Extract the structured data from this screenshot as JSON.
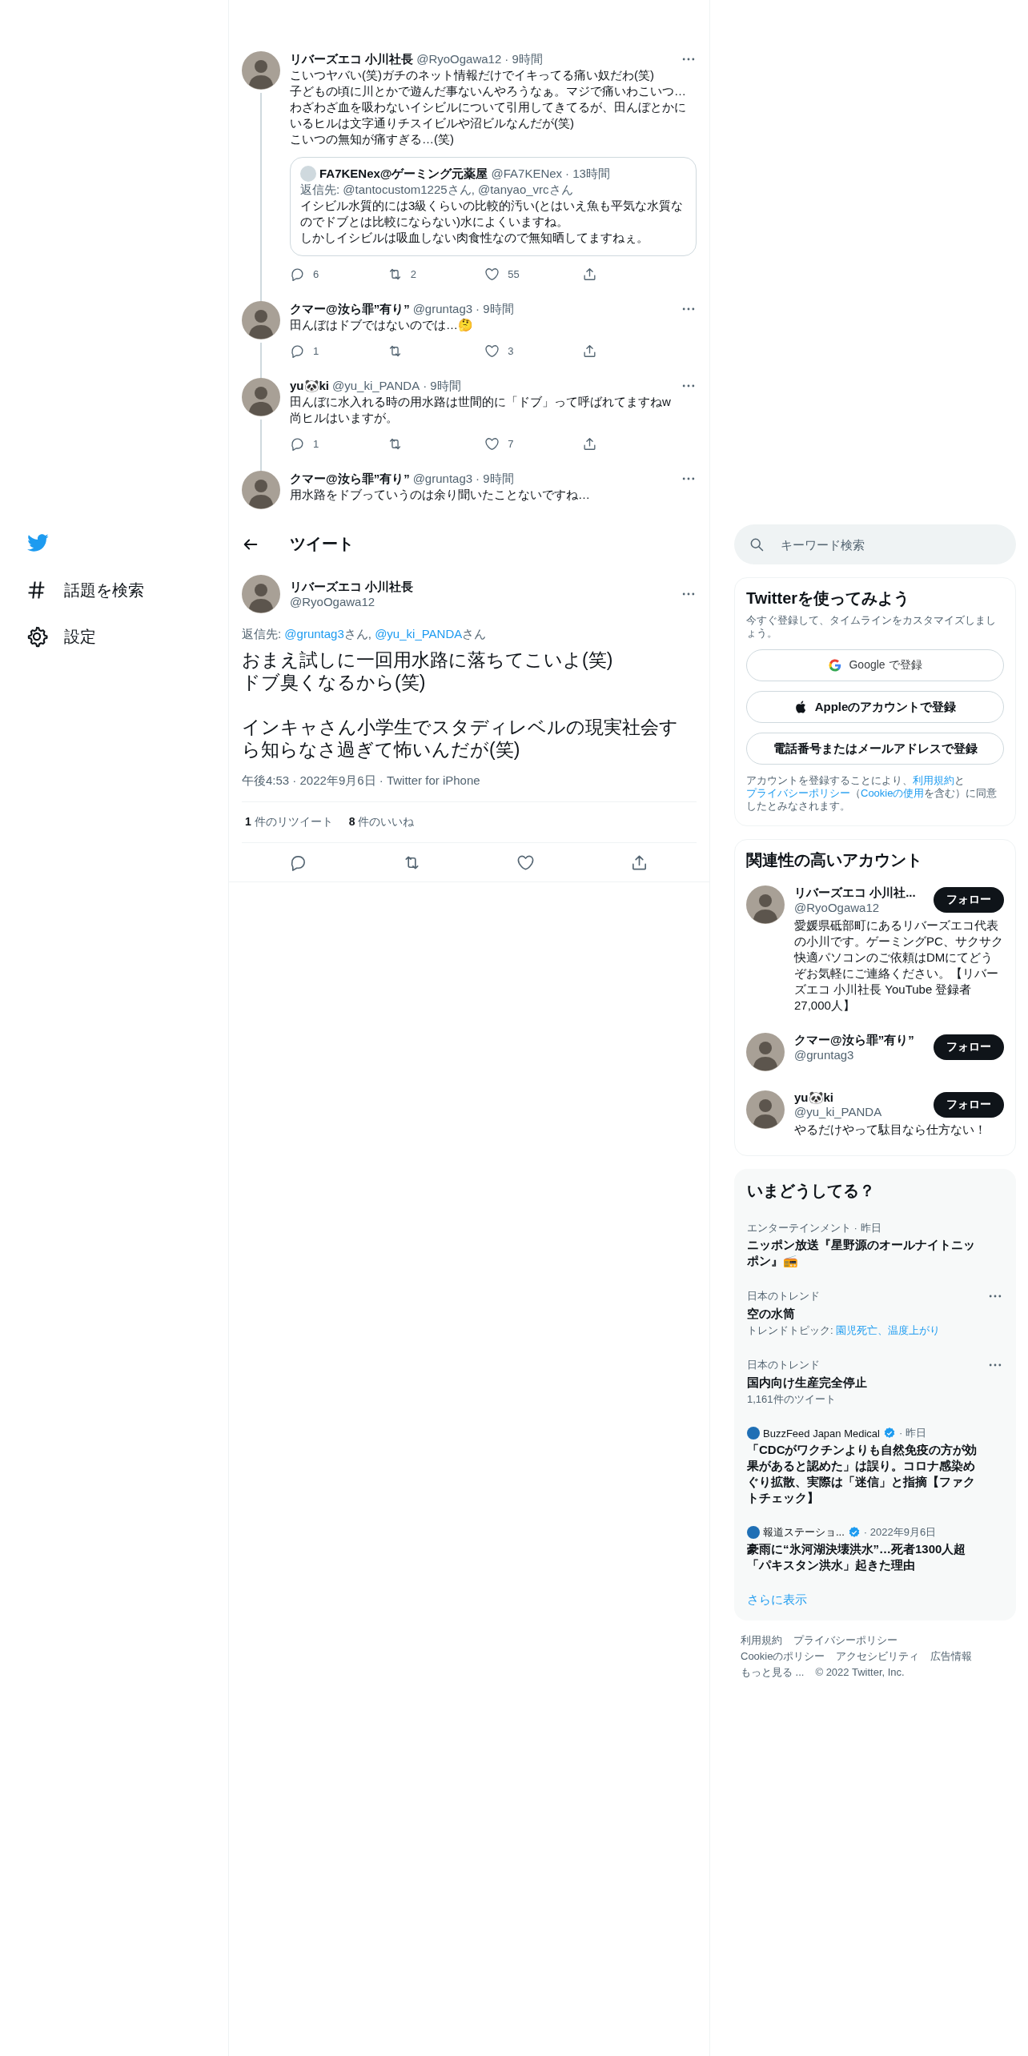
{
  "sidebar": {
    "items": [
      {
        "kind": "hash",
        "label": "話題を検索"
      },
      {
        "kind": "gear",
        "label": "設定"
      }
    ]
  },
  "thread": [
    {
      "name": "リバーズエコ 小川社長",
      "handle": "@RyoOgawa12",
      "time": "· 9時間",
      "text": "こいつヤバい(笑)ガチのネット情報だけでイキってる痛い奴だわ(笑)\n子どもの頃に川とかで遊んだ事ないんやろうなぁ。マジで痛いわこいつ…\nわざわざ血を吸わないイシビルについて引用してきてるが、田んぼとかにいるヒルは文字通りチスイビルや沼ビルなんだが(笑)\nこいつの無知が痛すぎる…(笑)",
      "quote": {
        "name": "FA7KENex@ゲーミング元薬屋",
        "handle": "@FA7KENex",
        "time": "· 13時間",
        "reply": "返信先: @tantocustom1225さん, @tanyao_vrcさん",
        "lines": [
          "イシビル水質的には3級くらいの比較的汚い(とはいえ魚も平気な水質なのでドブとは比較にならない)水によくいますね。",
          "しかしイシビルは吸血しない肉食性なので無知晒してますねぇ。"
        ]
      },
      "actions": [
        {
          "kind": "reply",
          "count": "6"
        },
        {
          "kind": "retweet",
          "count": "2"
        },
        {
          "kind": "like",
          "count": "55"
        },
        {
          "kind": "share"
        }
      ]
    },
    {
      "name": "クマー@汝ら罪”有り”",
      "handle": "@gruntag3",
      "time": "· 9時間",
      "text": "田んぼはドブではないのでは…🤔",
      "actions": [
        {
          "kind": "reply",
          "count": "1"
        },
        {
          "kind": "retweet"
        },
        {
          "kind": "like",
          "count": "3"
        },
        {
          "kind": "share"
        }
      ]
    },
    {
      "name": "yu🐼ki",
      "handle": "@yu_ki_PANDA",
      "time": "· 9時間",
      "text": "田んぼに水入れる時の用水路は世間的に「ドブ」って呼ばれてますねw\n尚ヒルはいますが。",
      "actions": [
        {
          "kind": "reply",
          "count": "1"
        },
        {
          "kind": "retweet"
        },
        {
          "kind": "like",
          "count": "7"
        },
        {
          "kind": "share"
        }
      ]
    },
    {
      "name": "クマー@汝ら罪”有り”",
      "handle": "@gruntag3",
      "time": "· 9時間",
      "text": "用水路をドブっていうのは余り聞いたことないですね…"
    }
  ],
  "header": {
    "title": "ツイート"
  },
  "tweet": {
    "name": "リバーズエコ 小川社長",
    "handle": "@RyoOgawa12",
    "reply_to": {
      "label": "返信先: ",
      "parts": [
        {
          "text": "@gruntag3",
          "link": true
        },
        {
          "text": "さん, ",
          "link": false
        },
        {
          "text": "@yu_ki_PANDA",
          "link": true
        },
        {
          "text": "さん",
          "link": false
        }
      ]
    },
    "text": "おまえ試しに一回用水路に落ちてこいよ(笑)\nドブ臭くなるから(笑)\n\nインキャさん小学生でスタディレベルの現実社会すら知らなさ過ぎて怖いんだが(笑)",
    "time": "午後4:53 · 2022年9月6日 · Twitter for iPhone",
    "stats": [
      "**1** 件のリツイート",
      "**8** 件のいいね"
    ],
    "actions": [
      {
        "kind": "reply"
      },
      {
        "kind": "retweet"
      },
      {
        "kind": "like"
      },
      {
        "kind": "share"
      }
    ]
  },
  "search": {
    "placeholder": "キーワード検索"
  },
  "signup": {
    "title": "Twitterを使ってみよう",
    "subtitle": "今すぐ登録して、タイムラインをカスタマイズしましょう。",
    "buttons": [
      {
        "kind": "google",
        "label": "Google で登録"
      },
      {
        "kind": "apple",
        "label": "Appleのアカウントで登録"
      },
      {
        "kind": "plain",
        "label": "電話番号またはメールアドレスで登録"
      }
    ],
    "terms": [
      {
        "text": "アカウントを登録することにより、",
        "link": false
      },
      {
        "text": "利用規約",
        "link": true
      },
      {
        "text": "と",
        "link": false
      },
      {
        "text": "プライバシーポリシー",
        "link": true
      },
      {
        "text": "（",
        "link": false
      },
      {
        "text": "Cookieの使用",
        "link": true
      },
      {
        "text": "を含む）に同意したとみなされます。",
        "link": false
      }
    ]
  },
  "related": {
    "title": "関連性の高いアカウント",
    "accounts": [
      {
        "name": "リバーズエコ 小川社...",
        "handle": "@RyoOgawa12",
        "button": "フォロー",
        "bio": "愛媛県砥部町にあるリバーズエコ代表の小川です。ゲーミングPC、サクサク快適パソコンのご依頼はDMにてどうぞお気軽にご連絡ください。【リバーズエコ 小川社長 YouTube 登録者27,000人】"
      },
      {
        "name": "クマー@汝ら罪”有り”",
        "handle": "@gruntag3",
        "button": "フォロー"
      },
      {
        "name": "yu🐼ki",
        "handle": "@yu_ki_PANDA",
        "button": "フォロー",
        "bio": "やるだけやって駄目なら仕方ない！"
      }
    ]
  },
  "trends": {
    "title": "いまどうしてる？",
    "items": [
      {
        "kind": "trend",
        "context": "エンターテインメント · 昨日",
        "title": "ニッポン放送『星野源のオールナイトニッポン』📻",
        "more": false
      },
      {
        "kind": "trend",
        "context": "日本のトレンド",
        "title": "空の水筒",
        "topics": {
          "label": "トレンドトピック: ",
          "links": "園児死亡、温度上がり"
        },
        "more": true
      },
      {
        "kind": "trend",
        "context": "日本のトレンド",
        "title": "国内向け生産完全停止",
        "meta": "1,161件のツイート",
        "more": true
      },
      {
        "kind": "news",
        "source": "BuzzFeed Japan Medical",
        "verified": true,
        "time": "· 昨日",
        "title": "「CDCがワクチンよりも自然免疫の方が効果があると認めた」は誤り。コロナ感染めぐり拡散、実際は「迷信」と指摘【ファクトチェック】"
      },
      {
        "kind": "news",
        "source": "報道ステーショ...",
        "verified": true,
        "time": "· 2022年9月6日",
        "title": "豪雨に“氷河湖決壊洪水”…死者1300人超「パキスタン洪水」起きた理由"
      }
    ],
    "more_link": "さらに表示"
  },
  "footer": {
    "rows": [
      [
        "利用規約",
        "プライバシーポリシー"
      ],
      [
        "Cookieのポリシー",
        "アクセシビリティ",
        "広告情報"
      ],
      [
        "もっと見る ...",
        "© 2022 Twitter, Inc."
      ]
    ]
  }
}
